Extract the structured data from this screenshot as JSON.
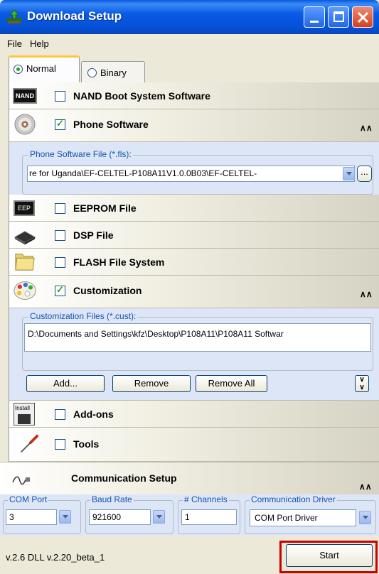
{
  "window": {
    "title": "Download Setup"
  },
  "menu": {
    "file": "File",
    "help": "Help"
  },
  "tabs": [
    {
      "label": "Normal",
      "selected": true
    },
    {
      "label": "Binary",
      "selected": false
    }
  ],
  "sections": {
    "nand": {
      "icon_label": "NAND",
      "title": "NAND Boot System Software",
      "checked": false
    },
    "phone": {
      "title": "Phone Software",
      "checked": true
    },
    "eeprom": {
      "icon_label": "EEP",
      "title": "EEPROM File",
      "checked": false
    },
    "dsp": {
      "title": "DSP File",
      "checked": false
    },
    "flash": {
      "title": "FLASH File System",
      "checked": false
    },
    "custom": {
      "title": "Customization",
      "checked": true
    },
    "addons": {
      "icon_label": "Install",
      "title": "Add-ons",
      "checked": false
    },
    "tools": {
      "title": "Tools",
      "checked": false
    }
  },
  "phone_software": {
    "group_label": "Phone Software File (*.fls):",
    "file_value": "re  for Uganda\\EF-CELTEL-P108A11V1.0.0B03\\EF-CELTEL-",
    "browse_label": "..."
  },
  "customization": {
    "group_label": "Customization Files (*.cust):",
    "file_item": "D:\\Documents and Settings\\kfz\\Desktop\\P108A11\\P108A11 Softwar",
    "add_label": "Add...",
    "remove_label": "Remove",
    "remove_all_label": "Remove All"
  },
  "communication": {
    "title": "Communication Setup",
    "com_port": {
      "label": "COM Port",
      "value": "3"
    },
    "baud_rate": {
      "label": "Baud Rate",
      "value": "921600"
    },
    "channels": {
      "label": "# Channels",
      "value": "1"
    },
    "driver": {
      "label": "Communication Driver",
      "value": "COM Port Driver"
    }
  },
  "status": {
    "version": "v.2.6  DLL v.2.20_beta_1",
    "start_label": "Start"
  },
  "colors": {
    "title_blue": "#0a5ae4",
    "sub_panel": "#dde6f7",
    "legend_blue": "#1453b0",
    "start_highlight": "#cc0000"
  }
}
